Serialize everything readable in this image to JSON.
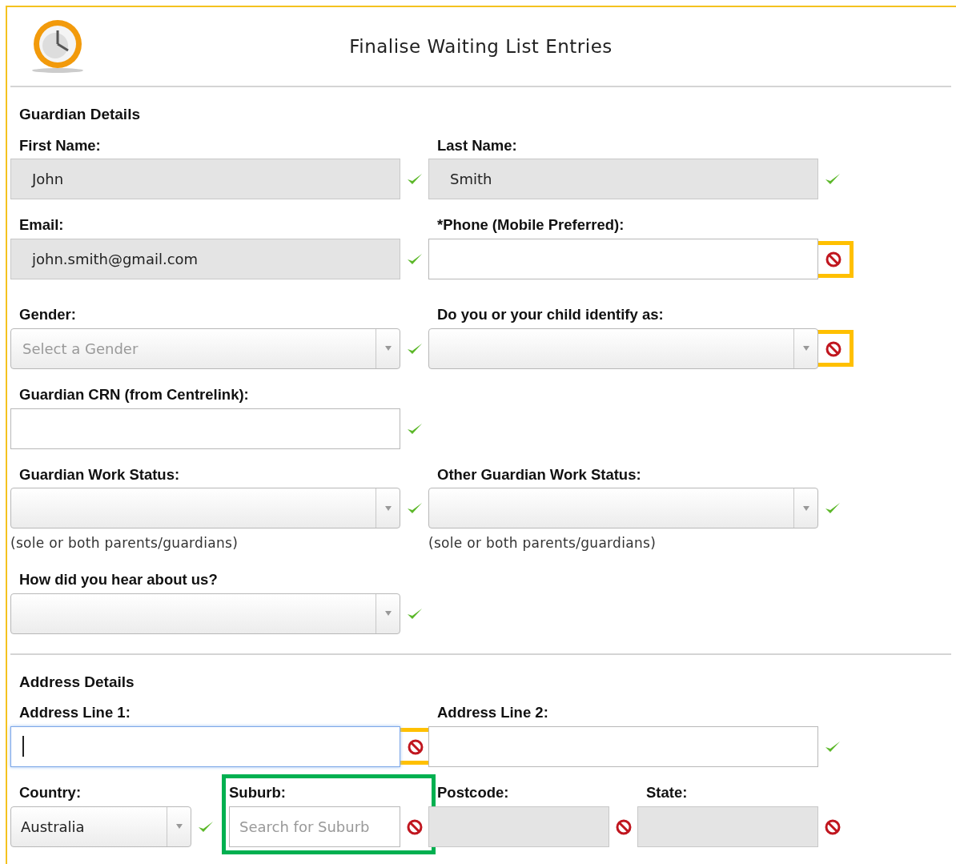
{
  "header": {
    "title": "Finalise Waiting List Entries"
  },
  "sections": [
    {
      "title": "Guardian Details",
      "rows": [
        [
          {
            "label": "First Name:",
            "kind": "text",
            "value": "John",
            "disabled": true,
            "valid": true
          },
          {
            "label": "Last Name:",
            "kind": "text",
            "value": "Smith",
            "disabled": true,
            "valid": true
          }
        ],
        [
          {
            "label": "Email:",
            "kind": "text",
            "value": "john.smith@gmail.com",
            "disabled": true,
            "valid": true
          },
          {
            "label": "*Phone (Mobile Preferred):",
            "kind": "text",
            "disabled": false,
            "valid": false,
            "icon_highlighted": true
          }
        ],
        [
          {
            "label": "Gender:",
            "kind": "select",
            "placeholder": "Select a Gender",
            "disabled": false,
            "valid": true
          },
          {
            "label": "Do you or your child identify as:",
            "kind": "select",
            "disabled": false,
            "valid": false,
            "icon_highlighted": true
          }
        ],
        [
          {
            "label": "Guardian CRN (from Centrelink):",
            "kind": "text",
            "disabled": false,
            "valid": true
          }
        ],
        [
          {
            "label": "Guardian Work Status:",
            "kind": "select",
            "disabled": false,
            "valid": true,
            "note": "(sole or both parents/guardians)"
          },
          {
            "label": "Other Guardian Work Status:",
            "kind": "select",
            "disabled": false,
            "valid": true,
            "note": "(sole or both parents/guardians)"
          }
        ],
        [
          {
            "label": "How did you hear about us?",
            "kind": "select",
            "disabled": false,
            "valid": true
          }
        ]
      ]
    },
    {
      "title": "Address Details",
      "rows": [
        [
          {
            "label": "Address Line 1:",
            "kind": "text",
            "disabled": false,
            "valid": false,
            "focused": true,
            "icon_highlighted": true
          },
          {
            "label": "Address Line 2:",
            "kind": "text",
            "disabled": false,
            "valid": true
          }
        ]
      ],
      "location_fields": [
        {
          "label": "Country:",
          "kind": "select",
          "value": "Australia",
          "disabled": false,
          "valid": true
        },
        {
          "label": "Suburb:",
          "kind": "text",
          "placeholder": "Search for Suburb",
          "disabled": false,
          "valid": false,
          "field_highlighted": true
        },
        {
          "label": "Postcode:",
          "kind": "text",
          "disabled": true,
          "valid": false
        },
        {
          "label": "State:",
          "kind": "text",
          "disabled": true,
          "valid": false
        }
      ]
    }
  ]
}
